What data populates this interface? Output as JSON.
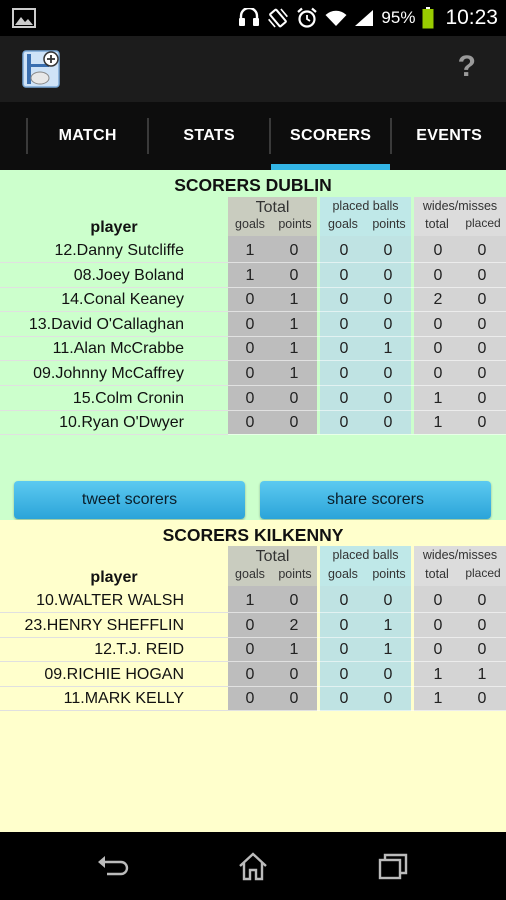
{
  "status": {
    "battery_pct": "95%",
    "time": "10:23"
  },
  "tabs": [
    {
      "label": "MATCH",
      "active": false
    },
    {
      "label": "STATS",
      "active": false
    },
    {
      "label": "SCORERS",
      "active": true
    },
    {
      "label": "EVENTS",
      "active": false
    }
  ],
  "headers": {
    "player": "player",
    "total": "Total",
    "placed_balls": "placed balls",
    "wides_misses": "wides/misses",
    "goals": "goals",
    "points": "points",
    "total_sub": "total",
    "placed_sub": "placed"
  },
  "dublin": {
    "title": "SCORERS DUBLIN",
    "rows": [
      {
        "player": "12.Danny Sutcliffe",
        "goals": "1",
        "points": "0",
        "pb_goals": "0",
        "pb_points": "0",
        "wm_total": "0",
        "wm_placed": "0"
      },
      {
        "player": "08.Joey Boland",
        "goals": "1",
        "points": "0",
        "pb_goals": "0",
        "pb_points": "0",
        "wm_total": "0",
        "wm_placed": "0"
      },
      {
        "player": "14.Conal Keaney",
        "goals": "0",
        "points": "1",
        "pb_goals": "0",
        "pb_points": "0",
        "wm_total": "2",
        "wm_placed": "0"
      },
      {
        "player": "13.David O'Callaghan",
        "goals": "0",
        "points": "1",
        "pb_goals": "0",
        "pb_points": "0",
        "wm_total": "0",
        "wm_placed": "0"
      },
      {
        "player": "11.Alan McCrabbe",
        "goals": "0",
        "points": "1",
        "pb_goals": "0",
        "pb_points": "1",
        "wm_total": "0",
        "wm_placed": "0"
      },
      {
        "player": "09.Johnny McCaffrey",
        "goals": "0",
        "points": "1",
        "pb_goals": "0",
        "pb_points": "0",
        "wm_total": "0",
        "wm_placed": "0"
      },
      {
        "player": "15.Colm Cronin",
        "goals": "0",
        "points": "0",
        "pb_goals": "0",
        "pb_points": "0",
        "wm_total": "1",
        "wm_placed": "0"
      },
      {
        "player": "10.Ryan O'Dwyer",
        "goals": "0",
        "points": "0",
        "pb_goals": "0",
        "pb_points": "0",
        "wm_total": "1",
        "wm_placed": "0"
      }
    ]
  },
  "buttons": {
    "tweet": "tweet scorers",
    "share": "share scorers"
  },
  "kilkenny": {
    "title": "SCORERS KILKENNY",
    "rows": [
      {
        "player": "10.WALTER WALSH",
        "goals": "1",
        "points": "0",
        "pb_goals": "0",
        "pb_points": "0",
        "wm_total": "0",
        "wm_placed": "0"
      },
      {
        "player": "23.HENRY SHEFFLIN",
        "goals": "0",
        "points": "2",
        "pb_goals": "0",
        "pb_points": "1",
        "wm_total": "0",
        "wm_placed": "0"
      },
      {
        "player": "12.T.J. REID",
        "goals": "0",
        "points": "1",
        "pb_goals": "0",
        "pb_points": "1",
        "wm_total": "0",
        "wm_placed": "0"
      },
      {
        "player": "09.RICHIE HOGAN",
        "goals": "0",
        "points": "0",
        "pb_goals": "0",
        "pb_points": "0",
        "wm_total": "1",
        "wm_placed": "1"
      },
      {
        "player": "11.MARK KELLY",
        "goals": "0",
        "points": "0",
        "pb_goals": "0",
        "pb_points": "0",
        "wm_total": "1",
        "wm_placed": "0"
      }
    ]
  },
  "colors": {
    "tab_indicator": "#33b5e5",
    "dublin_bg": "#ccffcc",
    "kilkenny_bg": "#ffffcc",
    "button": "#33b5e5"
  }
}
